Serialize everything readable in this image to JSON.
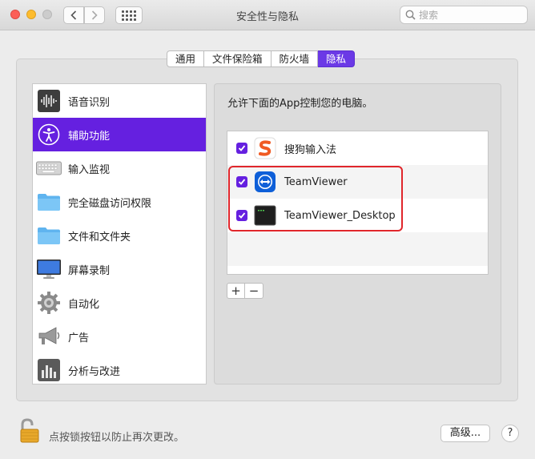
{
  "window": {
    "title": "安全性与隐私",
    "search_placeholder": "搜索"
  },
  "tabs": [
    {
      "label": "通用",
      "active": false
    },
    {
      "label": "文件保险箱",
      "active": false
    },
    {
      "label": "防火墙",
      "active": false
    },
    {
      "label": "隐私",
      "active": true
    }
  ],
  "sidebar": {
    "items": [
      {
        "label": "语音识别",
        "icon": "speech-recognition-icon",
        "selected": false
      },
      {
        "label": "辅助功能",
        "icon": "accessibility-icon",
        "selected": true
      },
      {
        "label": "输入监视",
        "icon": "keyboard-icon",
        "selected": false
      },
      {
        "label": "完全磁盘访问权限",
        "icon": "folder-icon",
        "selected": false
      },
      {
        "label": "文件和文件夹",
        "icon": "folder-icon",
        "selected": false
      },
      {
        "label": "屏幕录制",
        "icon": "display-icon",
        "selected": false
      },
      {
        "label": "自动化",
        "icon": "gear-icon",
        "selected": false
      },
      {
        "label": "广告",
        "icon": "megaphone-icon",
        "selected": false
      },
      {
        "label": "分析与改进",
        "icon": "analytics-icon",
        "selected": false
      }
    ]
  },
  "main": {
    "description": "允许下面的App控制您的电脑。",
    "apps": [
      {
        "name": "搜狗输入法",
        "checked": true,
        "icon": "sogou-icon"
      },
      {
        "name": "TeamViewer",
        "checked": true,
        "icon": "teamviewer-icon"
      },
      {
        "name": "TeamViewer_Desktop",
        "checked": true,
        "icon": "terminal-icon"
      }
    ],
    "add_label": "+",
    "remove_label": "−"
  },
  "footer": {
    "lock_text": "点按锁按钮以防止再次更改。",
    "advanced_label": "高级...",
    "help_label": "?"
  },
  "colors": {
    "accent": "#6520e0",
    "highlight_border": "#e0262b"
  }
}
